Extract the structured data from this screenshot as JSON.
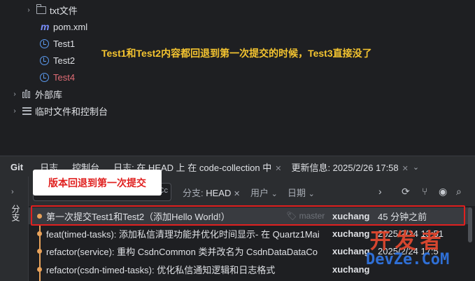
{
  "tree": {
    "items": [
      {
        "label": "txt文件",
        "icon": "folder-icon"
      },
      {
        "label": "pom.xml",
        "icon": "maven-icon"
      },
      {
        "label": "Test1",
        "icon": "test-class-icon"
      },
      {
        "label": "Test2",
        "icon": "test-class-icon"
      },
      {
        "label": "Test4",
        "icon": "test-class-icon"
      },
      {
        "label": "外部库",
        "icon": "library-icon"
      },
      {
        "label": "临时文件和控制台",
        "icon": "scratch-icon"
      }
    ]
  },
  "annotation": {
    "note": "Test1和Test2内容都回退到第一次提交的时候，Test3直接没了",
    "callout": "版本回退到第一次提交"
  },
  "git": {
    "tool_title": "Git",
    "tabs": [
      "日志",
      "控制台",
      "日志: 在 HEAD 上 在 code-collection 中"
    ],
    "update_info": "更新信息: 2025/2/26 17:58",
    "side_label": "分支",
    "search_case_toggle": "Cc",
    "filters": {
      "branch_label": "分支:",
      "branch_value": "HEAD",
      "user_label": "用户",
      "date_label": "日期"
    },
    "commits": [
      {
        "message": "第一次提交Test1和Test2（添加Hello World!）",
        "tag": "master",
        "author": "xuchang",
        "date": "45 分钟之前"
      },
      {
        "message": "feat(timed-tasks): 添加私信清理功能并优化时间显示- 在 Quartz1Mai",
        "tag": "",
        "author": "xuchang",
        "date": "2025/2/24 13:51"
      },
      {
        "message": "refactor(service): 重构 CsdnCommon 类并改名为 CsdnDataDataCo",
        "tag": "",
        "author": "xuchang",
        "date": "2025/2/24 17:5"
      },
      {
        "message": "refactor(csdn-timed-tasks): 优化私信通知逻辑和日志格式",
        "tag": "",
        "author": "xuchang",
        "date": ""
      }
    ]
  },
  "watermark": {
    "cn": "开发者",
    "en": "DevZe.CoM"
  },
  "colors": {
    "annotation_yellow": "#f4c430",
    "highlight_red": "#e0201f",
    "commit_dot": "#e8a25a"
  }
}
